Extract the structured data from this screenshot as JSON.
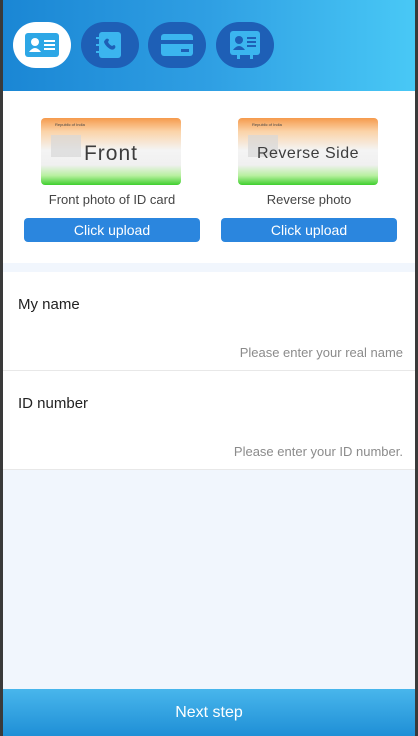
{
  "steps": [
    {
      "icon": "id-card-icon",
      "active": true
    },
    {
      "icon": "contact-phone-icon",
      "active": false
    },
    {
      "icon": "bank-card-icon",
      "active": false
    },
    {
      "icon": "profile-info-icon",
      "active": false
    }
  ],
  "upload": {
    "front": {
      "card_text": "Front",
      "card_header": "Republic of India",
      "caption": "Front photo of ID card",
      "button": "Click upload"
    },
    "back": {
      "card_text": "Reverse Side",
      "card_header": "Republic of India",
      "caption": "Reverse photo",
      "button": "Click upload"
    }
  },
  "form": {
    "name": {
      "label": "My name",
      "placeholder": "Please enter your real name"
    },
    "id": {
      "label": "ID number",
      "placeholder": "Please enter your ID number."
    }
  },
  "footer": {
    "next_label": "Next step"
  },
  "colors": {
    "accent": "#2b86de",
    "header_start": "#1a86d4",
    "header_end": "#49c9f6"
  }
}
